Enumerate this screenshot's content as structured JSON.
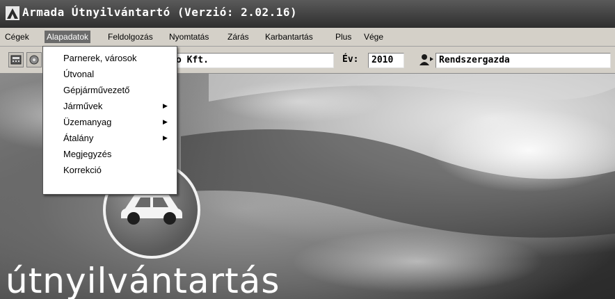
{
  "window": {
    "title": "Armada Útnyilvántartó (Verzió: 2.02.16)"
  },
  "menubar": {
    "items": [
      {
        "label": "Cégek"
      },
      {
        "label": "Alapadatok"
      },
      {
        "label": "Feldolgozás"
      },
      {
        "label": "Nyomtatás"
      },
      {
        "label": "Zárás"
      },
      {
        "label": "Karbantartás"
      },
      {
        "label": "Plus"
      },
      {
        "label": "Vége"
      }
    ],
    "active": "Alapadatok"
  },
  "toolbar": {
    "company_value": "o Kft.",
    "year_label": "Év:",
    "year_value": "2010",
    "user_value": "Rendszergazda"
  },
  "dropdown": {
    "items": [
      {
        "label": "Parnerek, városok",
        "submenu": false
      },
      {
        "label": "Útvonal",
        "submenu": false
      },
      {
        "label": "Gépjárművezető",
        "submenu": false
      },
      {
        "label": "Járművek",
        "submenu": true
      },
      {
        "label": "Üzemanyag",
        "submenu": true
      },
      {
        "label": "Átalány",
        "submenu": true
      },
      {
        "label": "Megjegyzés",
        "submenu": false
      },
      {
        "label": "Korrekció",
        "submenu": false
      }
    ],
    "submenu_arrow": "▶"
  },
  "background": {
    "brand_text": "útnyilvántartás"
  }
}
